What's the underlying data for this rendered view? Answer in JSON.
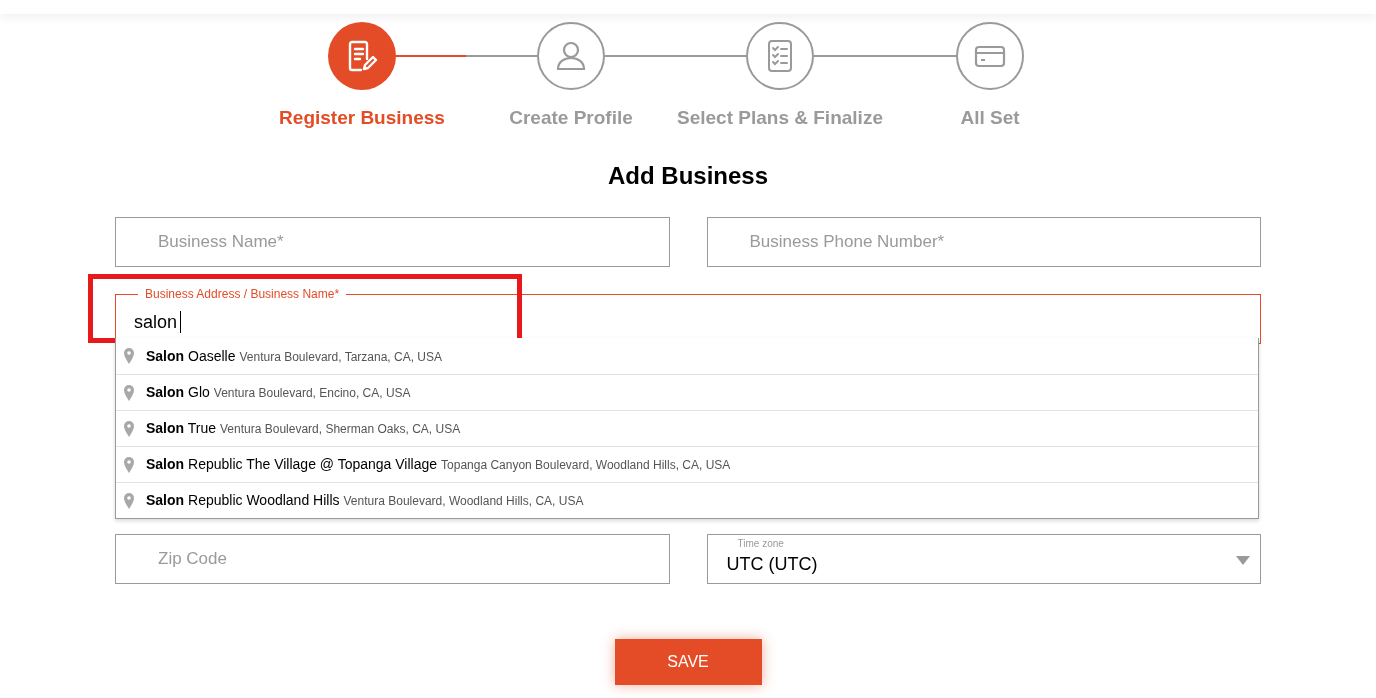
{
  "steps": [
    {
      "label": "Register Business",
      "selected": true
    },
    {
      "label": "Create Profile",
      "selected": false
    },
    {
      "label": "Select Plans & Finalize",
      "selected": false
    },
    {
      "label": "All Set",
      "selected": false
    }
  ],
  "title": "Add Business",
  "fields": [
    {
      "placeholder": "Business Name*"
    },
    {
      "placeholder": "Business Phone Number*"
    }
  ],
  "address_field": {
    "label": "Business Address / Business Name*",
    "value": "salon",
    "focused": true,
    "highlighted": true
  },
  "suggestions": [
    {
      "name": "**Salon** Oaselle",
      "address": "Ventura Boulevard, Tarzana, CA, USA"
    },
    {
      "name": "**Salon** Glo",
      "address": "Ventura Boulevard, Encino, CA, USA"
    },
    {
      "name": "**Salon** True",
      "address": "Ventura Boulevard, Sherman Oaks, CA, USA"
    },
    {
      "name": "**Salon** Republic The Village @ Topanga Village",
      "address": "Topanga Canyon Boulevard, Woodland Hills, CA, USA"
    },
    {
      "name": "**Salon** Republic Woodland Hills",
      "address": "Ventura Boulevard, Woodland Hills, CA, USA"
    }
  ],
  "zip_field": {
    "placeholder": "Zip Code"
  },
  "time_zone": {
    "label": "Time zone",
    "value": "UTC (UTC)"
  },
  "save_button": "SAVE"
}
